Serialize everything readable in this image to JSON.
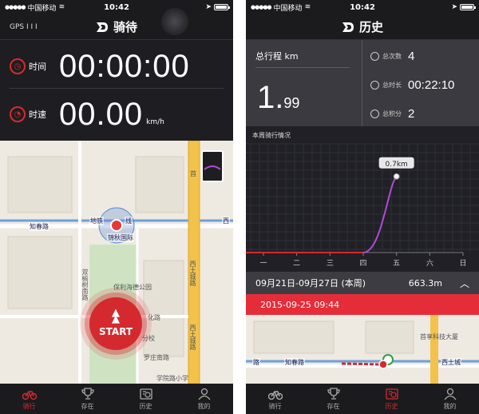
{
  "status": {
    "carrier": "中国移动",
    "time": "10:42"
  },
  "left": {
    "nav_title": "骑待",
    "gps_label": "GPS",
    "gps_bars": "I I I",
    "time_label": "时间",
    "time_value": "00:00:00",
    "speed_label": "时速",
    "speed_value": "00.00",
    "speed_unit": "km/h",
    "start_label": "START",
    "map": {
      "labels": [
        "知春路",
        "地铁",
        "线",
        "锦秋国际",
        "保利海德公园",
        "双榆树南路",
        "化路",
        "分校",
        "罗庄南路",
        "学院路小学",
        "西土城路",
        "西土城路",
        "首",
        "西"
      ]
    }
  },
  "right": {
    "nav_title": "历史",
    "total_distance_label": "总行程 km",
    "total_distance_int": "1.",
    "total_distance_dec": "99",
    "count_label": "总次数",
    "count_value": "4",
    "duration_label": "总时长",
    "duration_value": "00:22:10",
    "points_label": "总积分",
    "points_value": "2",
    "chart_title": "本周骑行情况",
    "week_range": "09月21日-09月27日 (本周)",
    "week_total": "663.3m",
    "ride_date": "2015-09-25 09:44",
    "map": {
      "labels": [
        "首享科技大厦",
        "西土城",
        "知春路",
        "路"
      ]
    }
  },
  "chart_data": {
    "type": "line",
    "categories": [
      "一",
      "二",
      "三",
      "四",
      "五",
      "六",
      "日"
    ],
    "values": [
      0,
      0,
      0,
      0,
      0.7,
      null,
      null
    ],
    "annotations": [
      {
        "x": "五",
        "label": "0.7km"
      }
    ],
    "title": "本周骑行情况",
    "xlabel": "",
    "ylabel": "",
    "ylim": [
      0,
      1
    ],
    "grid": true
  },
  "tabs": [
    {
      "label": "骑行",
      "icon": "bicycle-icon"
    },
    {
      "label": "存在",
      "icon": "trophy-icon"
    },
    {
      "label": "历史",
      "icon": "history-icon"
    },
    {
      "label": "我的",
      "icon": "user-icon"
    }
  ],
  "colors": {
    "accent": "#d42a2f",
    "ride_date_bg": "#e52d3a",
    "chart_line": "#b04ad6",
    "nav_bg": "#1b1b1e",
    "panel_bg": "#1e1e22"
  }
}
